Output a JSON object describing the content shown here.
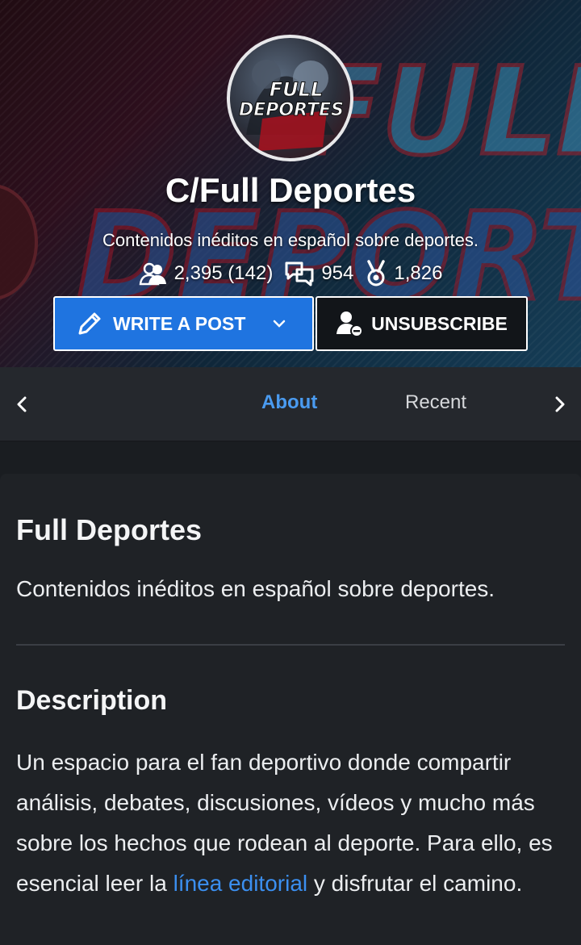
{
  "community": {
    "logo_text_line1": "FULL",
    "logo_text_line2": "DEPORTES",
    "banner_text_line1": "FULL",
    "banner_text_line2": "DEPORT",
    "title": "C/Full Deportes",
    "tagline": "Contenidos inéditos en español sobre deportes.",
    "stats": {
      "subscribers": "2,395 (142)",
      "posts": "954",
      "rewards": "1,826"
    }
  },
  "actions": {
    "write_post_label": "WRITE A POST",
    "unsubscribe_label": "UNSUBSCRIBE"
  },
  "tabs": [
    {
      "label": "About",
      "active": true
    },
    {
      "label": "Recent",
      "active": false
    }
  ],
  "about": {
    "title": "Full Deportes",
    "summary": "Contenidos inéditos en español sobre deportes.",
    "description_heading": "Description",
    "description_text_before": "Un espacio para el fan deportivo donde compartir análisis, debates, discusiones, vídeos y mucho más sobre los hechos que rodean al deporte. Para ello, es esencial leer la ",
    "description_link": "línea editorial",
    "description_text_after": " y disfrutar el camino."
  },
  "colors": {
    "accent_blue": "#1f74e0",
    "link_blue": "#3b8ff0",
    "active_tab": "#4a9bf0",
    "background": "#1a1d21"
  },
  "icons": {
    "subscribers": "people-icon",
    "posts": "chat-bubbles-icon",
    "rewards": "medal-icon",
    "write": "pencil-icon",
    "dropdown": "chevron-down-icon",
    "unsubscribe": "user-minus-icon",
    "tab_prev": "chevron-left-icon",
    "tab_next": "chevron-right-icon"
  }
}
